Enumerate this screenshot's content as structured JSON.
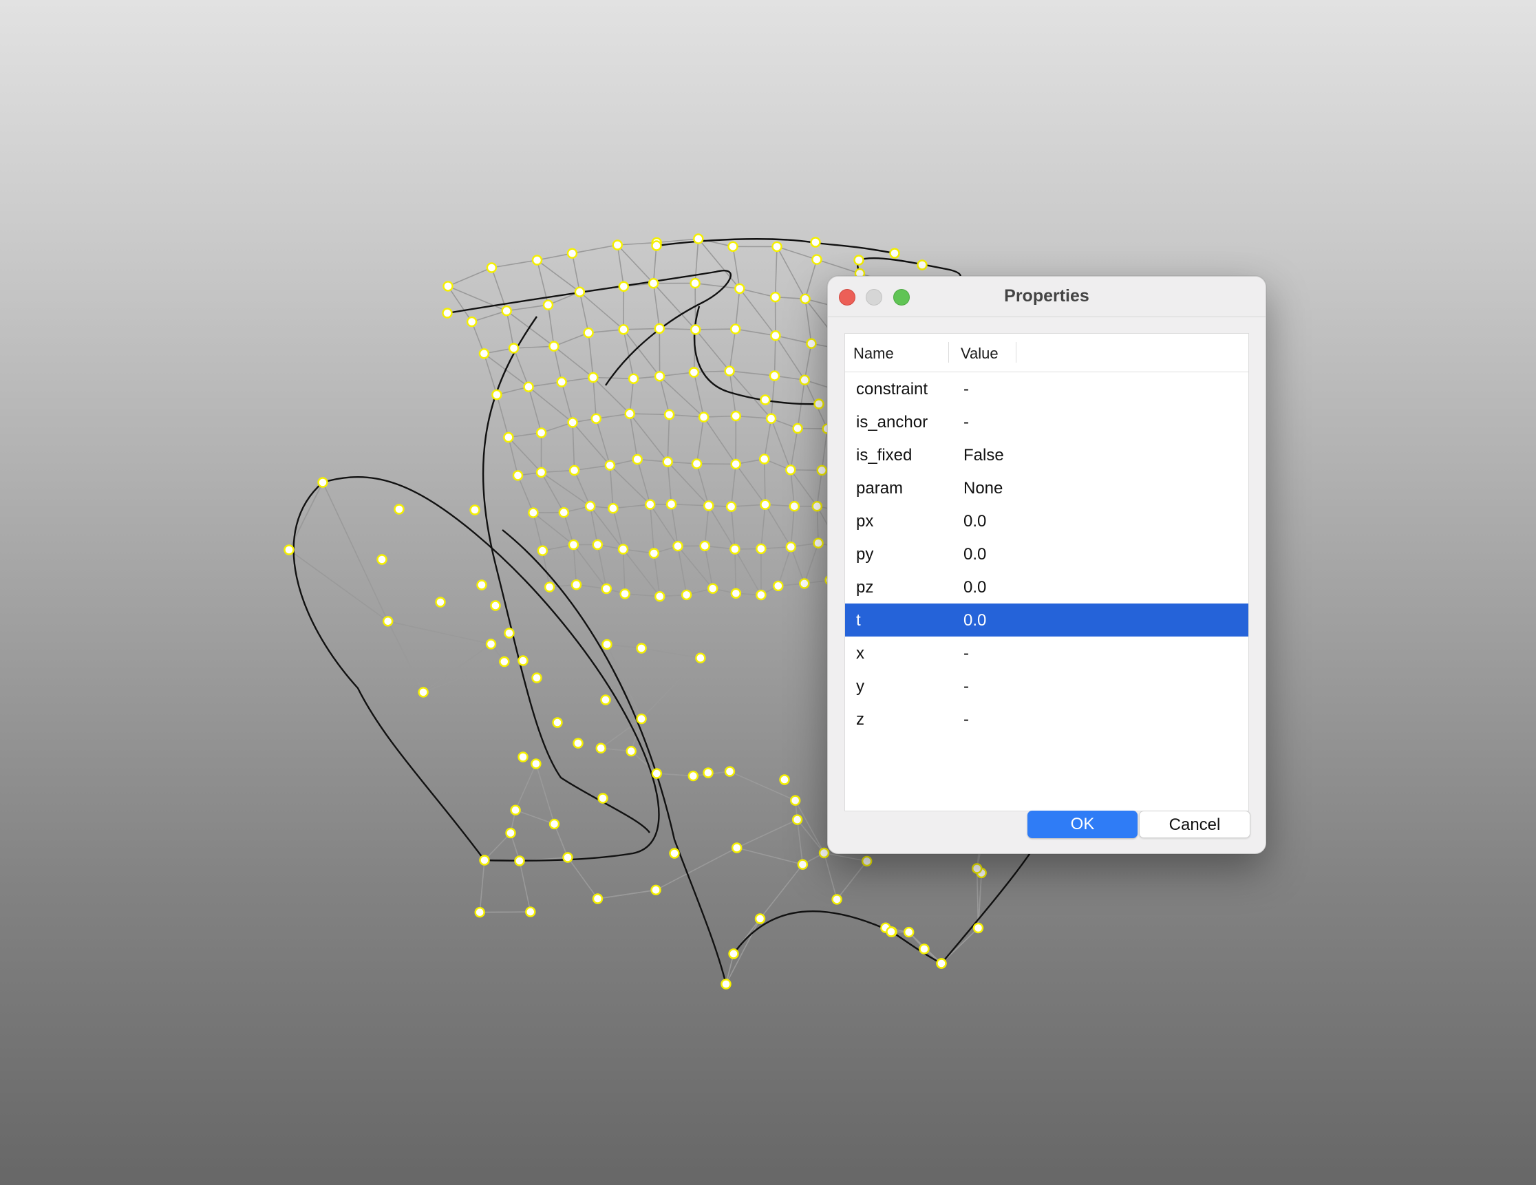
{
  "dialog": {
    "title": "Properties",
    "columns": {
      "name": "Name",
      "value": "Value"
    },
    "rows": [
      {
        "name": "constraint",
        "value": "-"
      },
      {
        "name": "is_anchor",
        "value": "-"
      },
      {
        "name": "is_fixed",
        "value": "False"
      },
      {
        "name": "param",
        "value": "None"
      },
      {
        "name": "px",
        "value": "0.0"
      },
      {
        "name": "py",
        "value": "0.0"
      },
      {
        "name": "pz",
        "value": "0.0"
      },
      {
        "name": "t",
        "value": "0.0",
        "selected": true
      },
      {
        "name": "x",
        "value": "-"
      },
      {
        "name": "y",
        "value": "-"
      },
      {
        "name": "z",
        "value": "-"
      }
    ],
    "buttons": {
      "ok": "OK",
      "cancel": "Cancel"
    }
  },
  "scene": {
    "point_fill": "#ffffff",
    "point_stroke": "#f5f000",
    "curve_color": "#111111",
    "mesh_color": "#9a9a9a"
  }
}
